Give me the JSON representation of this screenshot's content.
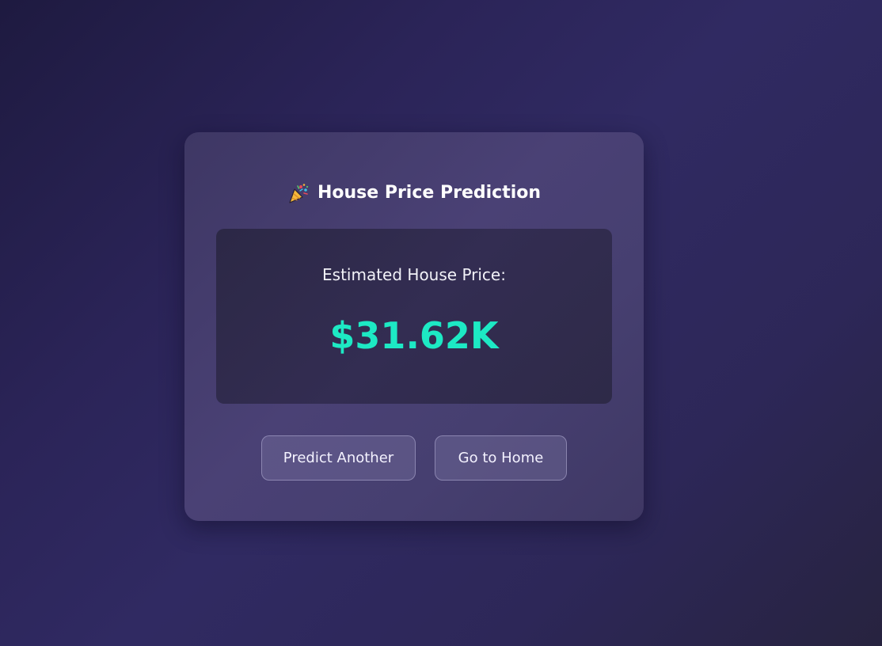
{
  "card": {
    "title": "House Price Prediction",
    "title_icon": "party-popper-icon"
  },
  "result": {
    "label": "Estimated House Price:",
    "value": "$31.62K",
    "value_color": "#1de9c4"
  },
  "actions": {
    "predict_another": "Predict Another",
    "go_home": "Go to Home"
  }
}
